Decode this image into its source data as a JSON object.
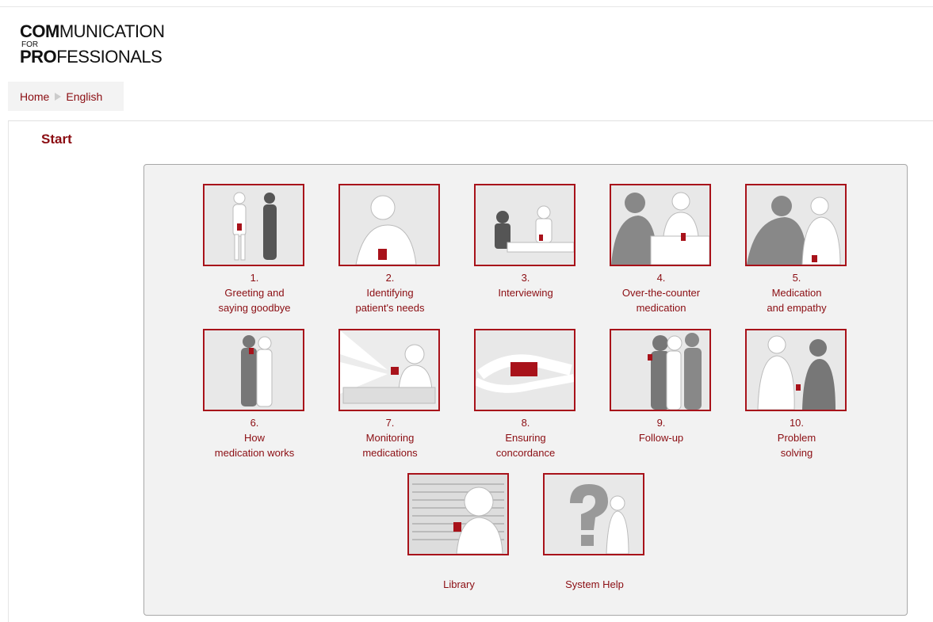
{
  "header": {
    "logo": {
      "line1_bold": "COM",
      "line1_rest": "MUNICATION",
      "line2": "FOR",
      "line3_bold": "PRO",
      "line3_rest": "FESSIONALS"
    }
  },
  "breadcrumb": {
    "home": "Home",
    "current": "English"
  },
  "page": {
    "title": "Start"
  },
  "modules": [
    {
      "num": "1.",
      "label": "Greeting and\nsaying goodbye"
    },
    {
      "num": "2.",
      "label": "Identifying\npatient's needs"
    },
    {
      "num": "3.",
      "label": "Interviewing"
    },
    {
      "num": "4.",
      "label": "Over-the-counter\nmedication"
    },
    {
      "num": "5.",
      "label": "Medication\nand empathy"
    },
    {
      "num": "6.",
      "label": "How\nmedication works"
    },
    {
      "num": "7.",
      "label": "Monitoring\nmedications"
    },
    {
      "num": "8.",
      "label": "Ensuring\nconcordance"
    },
    {
      "num": "9.",
      "label": "Follow-up"
    },
    {
      "num": "10.",
      "label": "Problem\nsolving"
    }
  ],
  "extras": [
    {
      "label": "Library"
    },
    {
      "label": "System Help"
    }
  ],
  "colors": {
    "accent": "#8b0d12",
    "border": "#a8121a",
    "panel": "#f2f2f2"
  }
}
